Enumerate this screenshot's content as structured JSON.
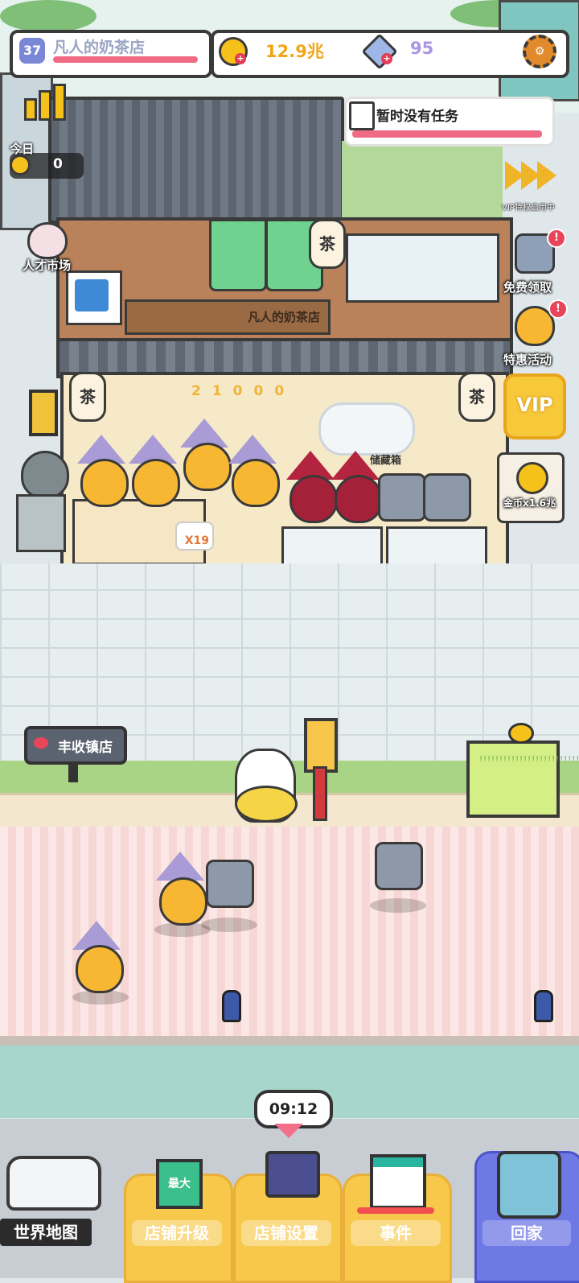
{
  "hud": {
    "level": "37",
    "shop_name": "凡人的奶茶店",
    "coins": "12.9兆",
    "gems": "95"
  },
  "task": {
    "text": "暂时没有任务"
  },
  "today": {
    "label": "今日",
    "value": "0"
  },
  "left_side": {
    "talent_market": "人才市场"
  },
  "right_side": {
    "vip_status": "VIP特权启用中",
    "free_claim": "免费领取",
    "special_offer": "特惠活动",
    "vip_button": "VIP",
    "gold_boost": "金币x1.6兆"
  },
  "shop": {
    "sign": "凡人的奶茶店",
    "lantern_char": "茶",
    "floating_digits": "21000",
    "order_badge": "X19",
    "storage_label": "储藏箱"
  },
  "town_sign": "丰收镇店",
  "board_text": "!!!!!!!!!!!!!!!!!!!!!!!!!!!!!",
  "timer": "09:12",
  "nav": {
    "world_map": "世界地图",
    "shop_upgrade": "店铺升级",
    "upgrade_badge": "最大",
    "shop_settings": "店铺设置",
    "events": "事件",
    "home": "回家"
  },
  "colors": {
    "accent_pink": "#f06a85",
    "coin_gold": "#f5c21b",
    "nav_yellow": "#f7c84a",
    "home_blue": "#6f79e6"
  }
}
